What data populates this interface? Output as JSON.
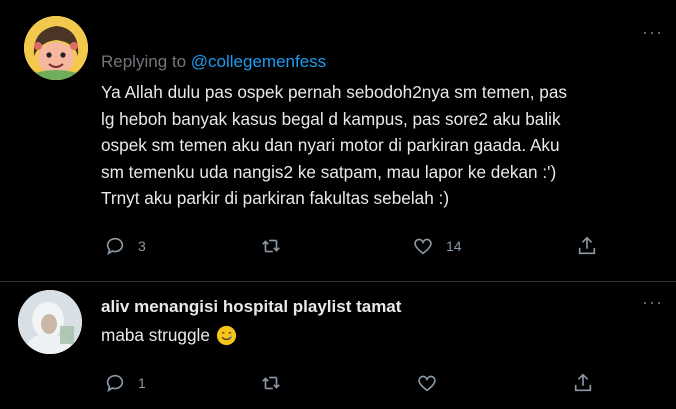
{
  "tweets": [
    {
      "replying_prefix": "Replying to ",
      "replying_handle": "@collegemenfess",
      "body_lines": [
        "Ya Allah dulu pas ospek pernah sebodoh2nya sm temen, pas",
        "lg heboh banyak kasus begal d kampus, pas sore2 aku balik",
        "ospek sm temen aku dan nyari motor di parkiran gaada. Aku",
        "sm temenku uda nangis2 ke satpam, mau lapor ke dekan :')",
        "Trnyt aku parkir di parkiran fakultas sebelah :)"
      ],
      "actions": {
        "reply_count": "3",
        "retweet_count": "",
        "like_count": "14"
      }
    },
    {
      "author_name": "aliv menangisi hospital playlist tamat",
      "body": "maba struggle",
      "emoji": "smiling-face-with-tear",
      "actions": {
        "reply_count": "1",
        "retweet_count": "",
        "like_count": ""
      }
    }
  ],
  "colors": {
    "background": "#000000",
    "text": "#e7e9ea",
    "muted": "#71767b",
    "mention": "#1d9bf0",
    "divider": "#2f3336"
  },
  "icons": {
    "reply": "reply-icon",
    "retweet": "retweet-icon",
    "like": "heart-icon",
    "share": "share-icon",
    "more": "more-options-icon"
  }
}
